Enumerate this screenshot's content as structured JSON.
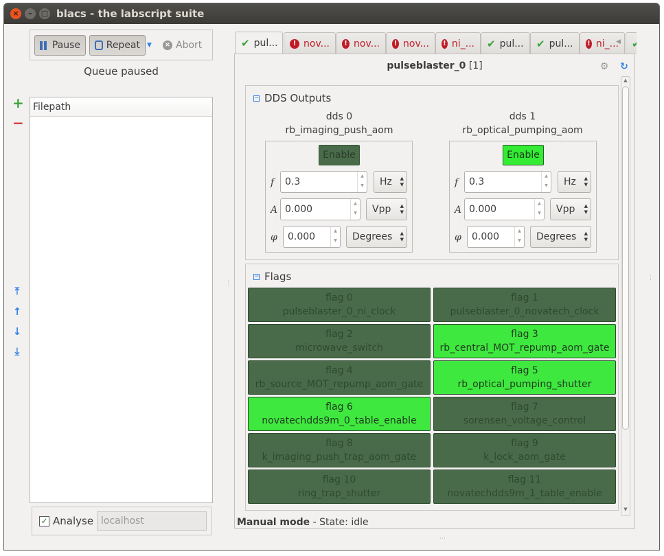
{
  "window": {
    "title": "blacs - the labscript suite"
  },
  "queue": {
    "pause_label": "Pause",
    "repeat_label": "Repeat",
    "abort_label": "Abort",
    "status": "Queue paused",
    "column_header": "Filepath"
  },
  "analysis": {
    "label": "Analyse",
    "host": "localhost"
  },
  "tabs": [
    {
      "label": "pul...",
      "state": "ok",
      "active": true
    },
    {
      "label": "nov...",
      "state": "error"
    },
    {
      "label": "nov...",
      "state": "error"
    },
    {
      "label": "nov...",
      "state": "error"
    },
    {
      "label": "ni_...",
      "state": "error"
    },
    {
      "label": "pul...",
      "state": "ok"
    },
    {
      "label": "pul...",
      "state": "ok"
    },
    {
      "label": "ni_...",
      "state": "error"
    }
  ],
  "device": {
    "name": "pulseblaster_0",
    "index": "[1]"
  },
  "dds_group": {
    "title": "DDS Outputs",
    "channels": [
      {
        "name": "dds 0",
        "connection": "rb_imaging_push_aom",
        "enable_label": "Enable",
        "enabled": false,
        "freq_symbol": "f",
        "freq": "0.3",
        "freq_unit": "Hz",
        "amp_symbol": "A",
        "amp": "0.000",
        "amp_unit": "Vpp",
        "phase_symbol": "φ",
        "phase": "0.000",
        "phase_unit": "Degrees"
      },
      {
        "name": "dds 1",
        "connection": "rb_optical_pumping_aom",
        "enable_label": "Enable",
        "enabled": true,
        "freq_symbol": "f",
        "freq": "0.3",
        "freq_unit": "Hz",
        "amp_symbol": "A",
        "amp": "0.000",
        "amp_unit": "Vpp",
        "phase_symbol": "φ",
        "phase": "0.000",
        "phase_unit": "Degrees"
      }
    ]
  },
  "flags_group": {
    "title": "Flags",
    "flags": [
      {
        "name": "flag 0",
        "connection": "pulseblaster_0_ni_clock",
        "on": false
      },
      {
        "name": "flag 1",
        "connection": "pulseblaster_0_novatech_clock",
        "on": false
      },
      {
        "name": "flag 2",
        "connection": "microwave_switch",
        "on": false
      },
      {
        "name": "flag 3",
        "connection": "rb_central_MOT_repump_aom_gate",
        "on": true
      },
      {
        "name": "flag 4",
        "connection": "rb_source_MOT_repump_aom_gate",
        "on": false
      },
      {
        "name": "flag 5",
        "connection": "rb_optical_pumping_shutter",
        "on": true
      },
      {
        "name": "flag 6",
        "connection": "novatechdds9m_0_table_enable",
        "on": true
      },
      {
        "name": "flag 7",
        "connection": "sorensen_voltage_control",
        "on": false
      },
      {
        "name": "flag 8",
        "connection": "k_imaging_push_trap_aom_gate",
        "on": false
      },
      {
        "name": "flag 9",
        "connection": "k_lock_aom_gate",
        "on": false
      },
      {
        "name": "flag 10",
        "connection": "ring_trap_shutter",
        "on": false
      },
      {
        "name": "flag 11",
        "connection": "novatechdds9m_1_table_enable",
        "on": false
      }
    ]
  },
  "status": {
    "mode": "Manual mode",
    "state_text": " - State: idle"
  }
}
